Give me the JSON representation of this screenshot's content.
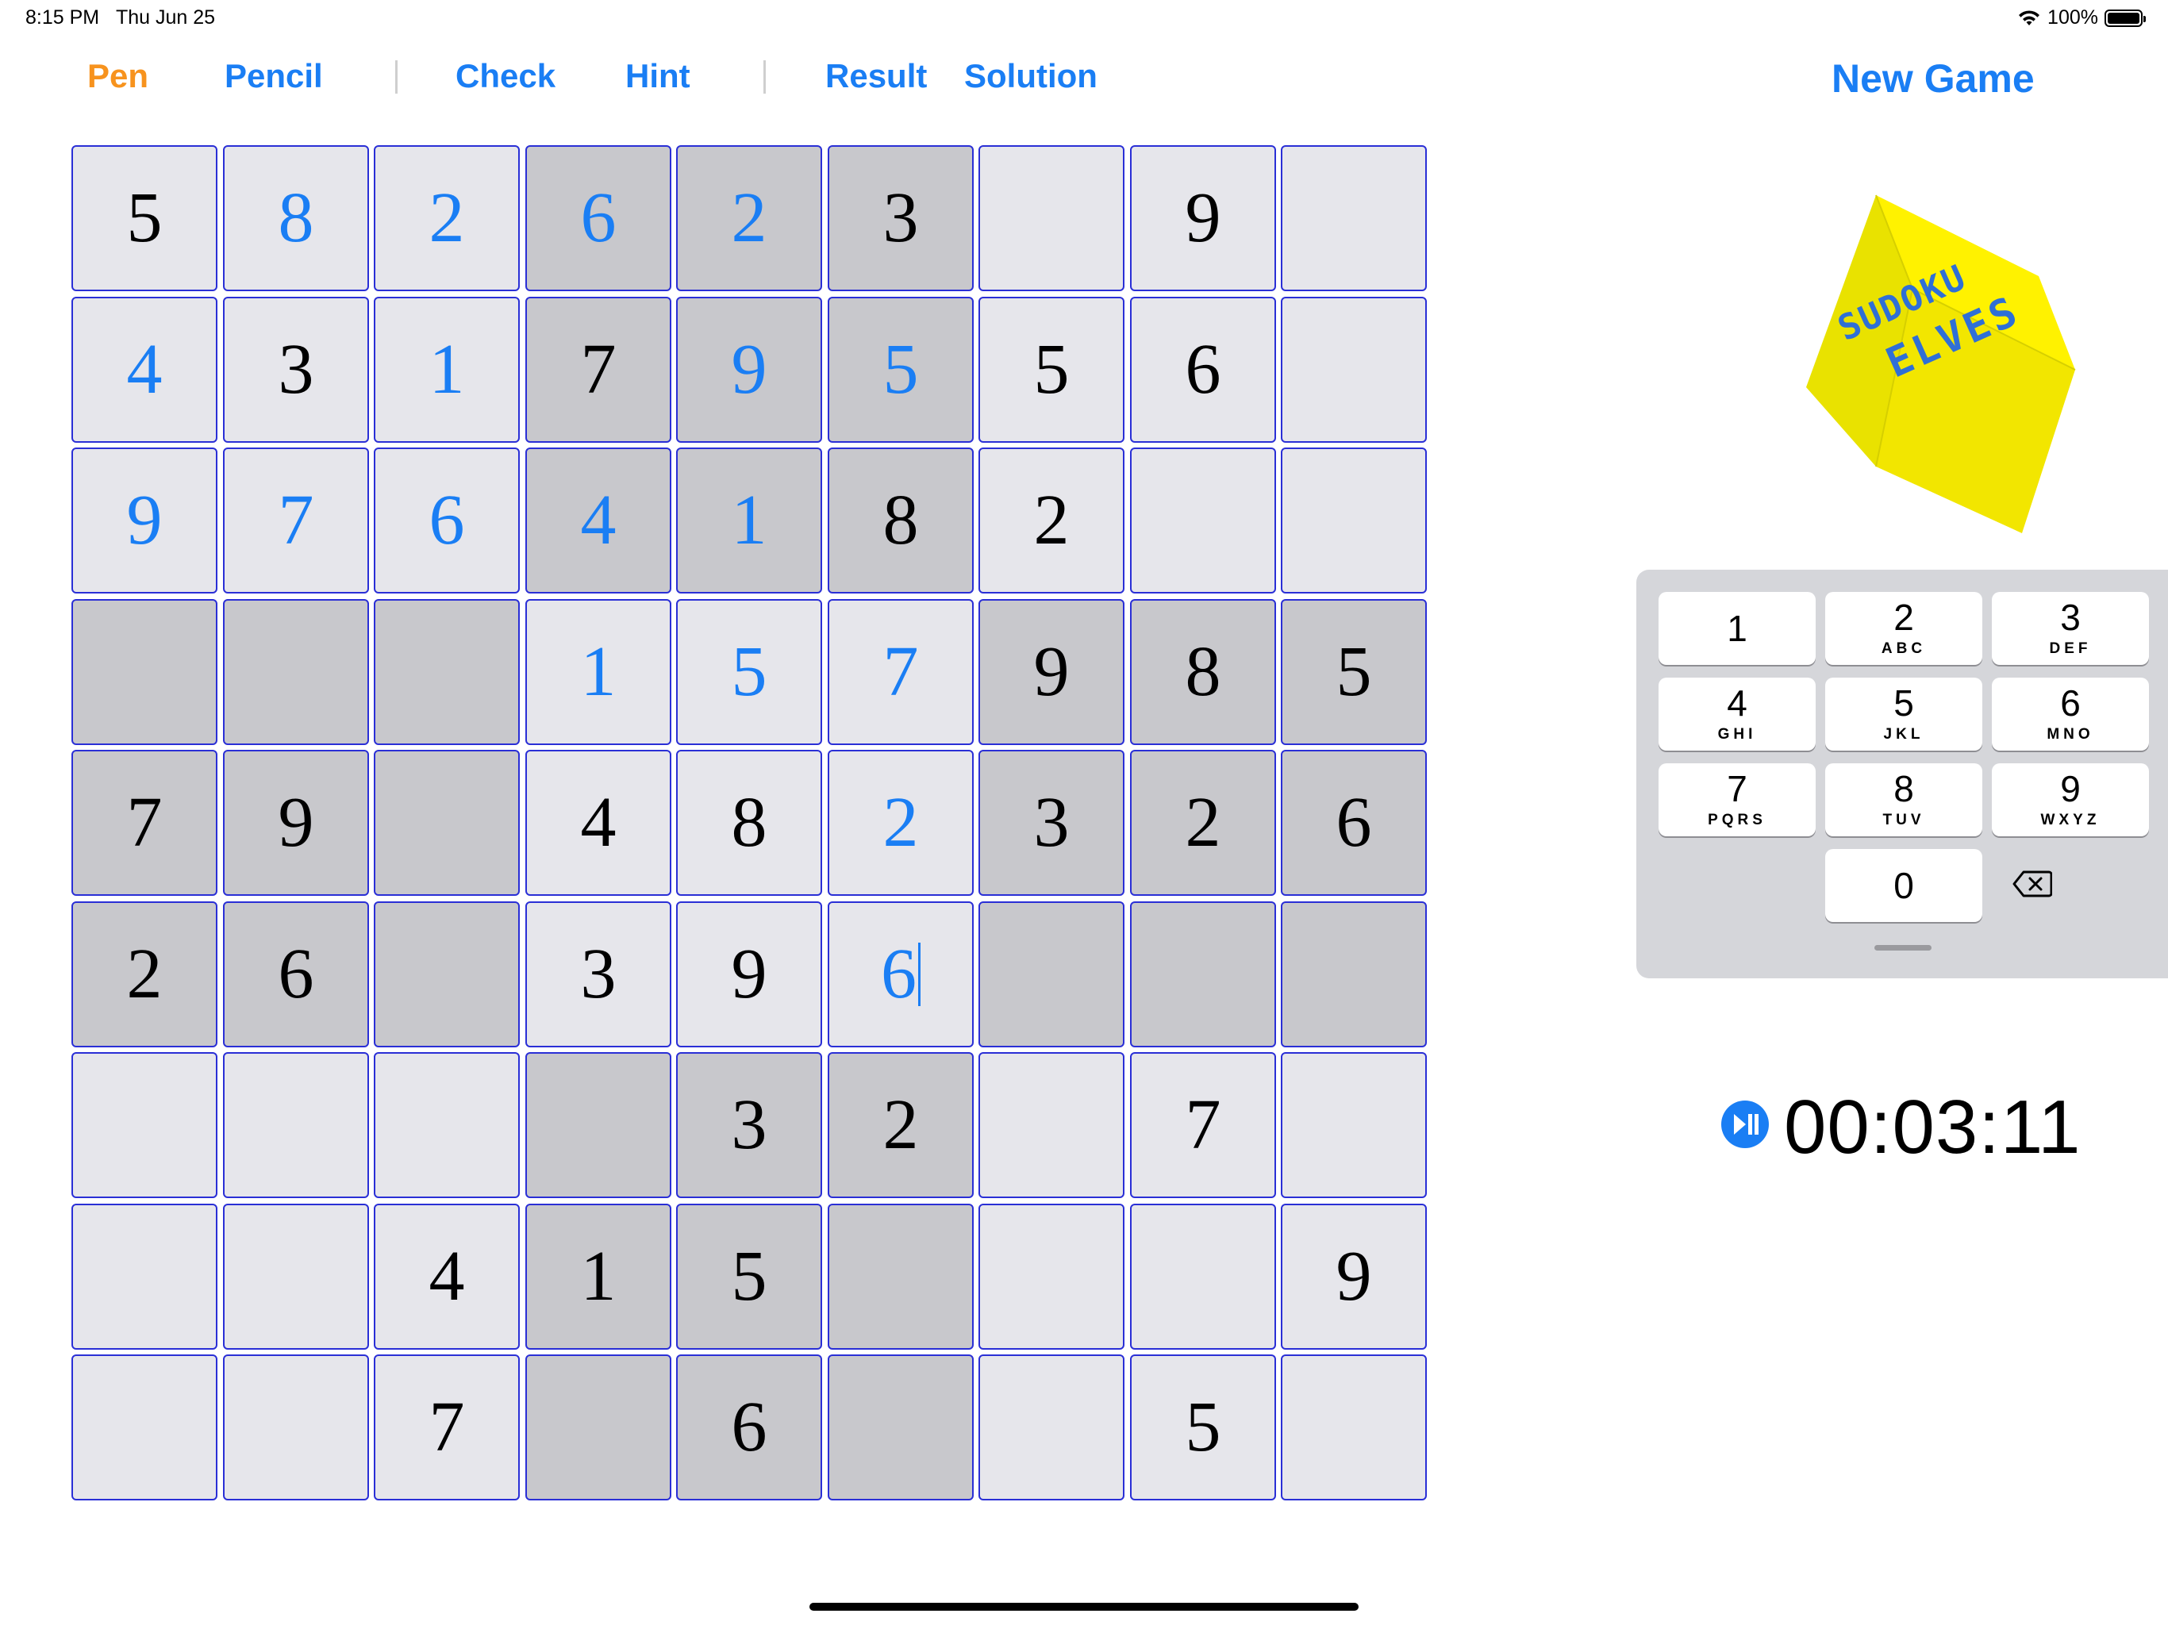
{
  "status": {
    "time": "8:15 PM",
    "date": "Thu Jun 25",
    "battery": "100%"
  },
  "toolbar": {
    "pen": "Pen",
    "pencil": "Pencil",
    "check": "Check",
    "hint": "Hint",
    "result": "Result",
    "solution": "Solution",
    "new_game": "New Game",
    "active_mode": "Pen"
  },
  "colors": {
    "accent": "#1a7ef4",
    "active_tool": "#f7931e",
    "cell_border": "#2a2fd6",
    "cell_light": "#e6e6eb",
    "cell_dark": "#c8c8cc",
    "logo_yellow": "#fff200"
  },
  "logo": {
    "line1": "SUDOKU",
    "line2": "ELVES"
  },
  "board": {
    "selected": [
      5,
      5
    ],
    "rows": [
      [
        {
          "v": "5",
          "t": "given"
        },
        {
          "v": "8",
          "t": "entered"
        },
        {
          "v": "2",
          "t": "entered"
        },
        {
          "v": "6",
          "t": "entered"
        },
        {
          "v": "2",
          "t": "entered"
        },
        {
          "v": "3",
          "t": "given"
        },
        {
          "v": "",
          "t": "empty"
        },
        {
          "v": "9",
          "t": "given"
        },
        {
          "v": "",
          "t": "empty"
        }
      ],
      [
        {
          "v": "4",
          "t": "entered"
        },
        {
          "v": "3",
          "t": "given"
        },
        {
          "v": "1",
          "t": "entered"
        },
        {
          "v": "7",
          "t": "given"
        },
        {
          "v": "9",
          "t": "entered"
        },
        {
          "v": "5",
          "t": "entered"
        },
        {
          "v": "5",
          "t": "given"
        },
        {
          "v": "6",
          "t": "given"
        },
        {
          "v": "",
          "t": "empty"
        }
      ],
      [
        {
          "v": "9",
          "t": "entered"
        },
        {
          "v": "7",
          "t": "entered"
        },
        {
          "v": "6",
          "t": "entered"
        },
        {
          "v": "4",
          "t": "entered"
        },
        {
          "v": "1",
          "t": "entered"
        },
        {
          "v": "8",
          "t": "given"
        },
        {
          "v": "2",
          "t": "given"
        },
        {
          "v": "",
          "t": "empty"
        },
        {
          "v": "",
          "t": "empty"
        }
      ],
      [
        {
          "v": "",
          "t": "empty"
        },
        {
          "v": "",
          "t": "empty"
        },
        {
          "v": "",
          "t": "empty"
        },
        {
          "v": "1",
          "t": "entered"
        },
        {
          "v": "5",
          "t": "entered"
        },
        {
          "v": "7",
          "t": "entered"
        },
        {
          "v": "9",
          "t": "given"
        },
        {
          "v": "8",
          "t": "given"
        },
        {
          "v": "5",
          "t": "given"
        }
      ],
      [
        {
          "v": "7",
          "t": "given"
        },
        {
          "v": "9",
          "t": "given"
        },
        {
          "v": "",
          "t": "empty"
        },
        {
          "v": "4",
          "t": "given"
        },
        {
          "v": "8",
          "t": "given"
        },
        {
          "v": "2",
          "t": "entered"
        },
        {
          "v": "3",
          "t": "given"
        },
        {
          "v": "2",
          "t": "given"
        },
        {
          "v": "6",
          "t": "given"
        }
      ],
      [
        {
          "v": "2",
          "t": "given"
        },
        {
          "v": "6",
          "t": "given"
        },
        {
          "v": "",
          "t": "empty"
        },
        {
          "v": "3",
          "t": "given"
        },
        {
          "v": "9",
          "t": "given"
        },
        {
          "v": "6",
          "t": "entered"
        },
        {
          "v": "",
          "t": "empty"
        },
        {
          "v": "",
          "t": "empty"
        },
        {
          "v": "",
          "t": "empty"
        }
      ],
      [
        {
          "v": "",
          "t": "empty"
        },
        {
          "v": "",
          "t": "empty"
        },
        {
          "v": "",
          "t": "empty"
        },
        {
          "v": "",
          "t": "empty"
        },
        {
          "v": "3",
          "t": "given"
        },
        {
          "v": "2",
          "t": "given"
        },
        {
          "v": "",
          "t": "empty"
        },
        {
          "v": "7",
          "t": "given"
        },
        {
          "v": "",
          "t": "empty"
        }
      ],
      [
        {
          "v": "",
          "t": "empty"
        },
        {
          "v": "",
          "t": "empty"
        },
        {
          "v": "4",
          "t": "given"
        },
        {
          "v": "1",
          "t": "given"
        },
        {
          "v": "5",
          "t": "given"
        },
        {
          "v": "",
          "t": "empty"
        },
        {
          "v": "",
          "t": "empty"
        },
        {
          "v": "",
          "t": "empty"
        },
        {
          "v": "9",
          "t": "given"
        }
      ],
      [
        {
          "v": "",
          "t": "empty"
        },
        {
          "v": "",
          "t": "empty"
        },
        {
          "v": "7",
          "t": "given"
        },
        {
          "v": "",
          "t": "empty"
        },
        {
          "v": "6",
          "t": "given"
        },
        {
          "v": "",
          "t": "empty"
        },
        {
          "v": "",
          "t": "empty"
        },
        {
          "v": "5",
          "t": "given"
        },
        {
          "v": "",
          "t": "empty"
        }
      ]
    ]
  },
  "keypad": {
    "keys": [
      {
        "num": "1",
        "letters": ""
      },
      {
        "num": "2",
        "letters": "ABC"
      },
      {
        "num": "3",
        "letters": "DEF"
      },
      {
        "num": "4",
        "letters": "GHI"
      },
      {
        "num": "5",
        "letters": "JKL"
      },
      {
        "num": "6",
        "letters": "MNO"
      },
      {
        "num": "7",
        "letters": "PQRS"
      },
      {
        "num": "8",
        "letters": "TUV"
      },
      {
        "num": "9",
        "letters": "WXYZ"
      },
      {
        "num": "0",
        "letters": ""
      }
    ],
    "delete_icon": "delete-backward-icon"
  },
  "timer": {
    "value": "00:03:11",
    "icon": "play-pause-icon"
  }
}
